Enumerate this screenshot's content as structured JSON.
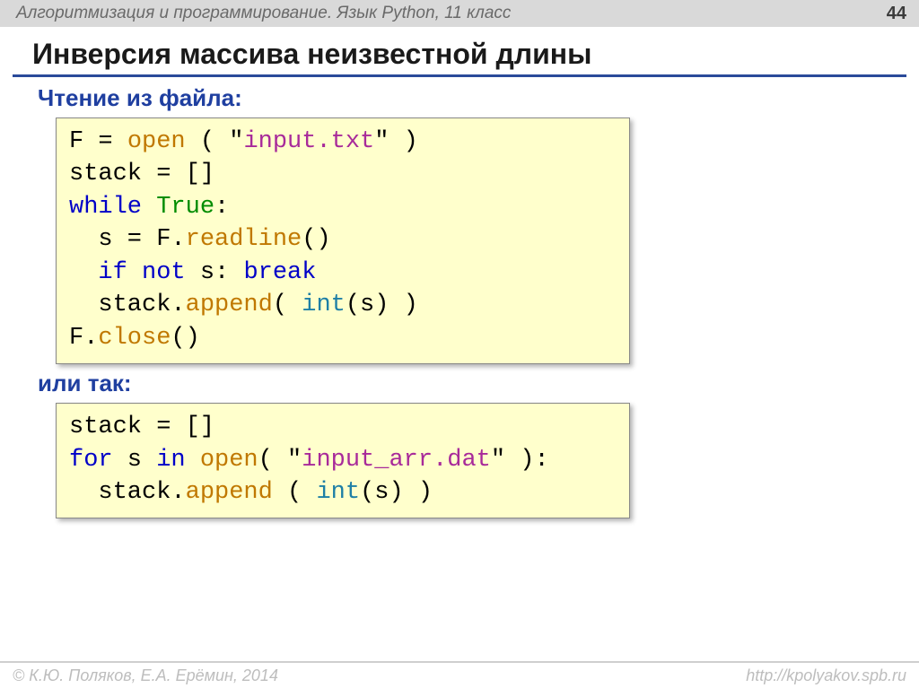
{
  "header": {
    "course": "Алгоритмизация и программирование. Язык Python, 11 класс",
    "page": "44"
  },
  "title": "Инверсия массива неизвестной длины",
  "section1": "Чтение из файла:",
  "code1": {
    "open": "open",
    "file1": "input.txt",
    "readline": "readline",
    "append": "append",
    "close": "close",
    "int": "int",
    "true": "True",
    "while": "while",
    "if": "if",
    "not": "not",
    "break": "break"
  },
  "section2": "или так:",
  "code2": {
    "for": "for",
    "in": "in",
    "open": "open",
    "file2": "input_arr.dat",
    "append": "append",
    "int": "int"
  },
  "footer": {
    "left": "© К.Ю. Поляков, Е.А. Ерёмин, 2014",
    "right": "http://kpolyakov.spb.ru"
  }
}
